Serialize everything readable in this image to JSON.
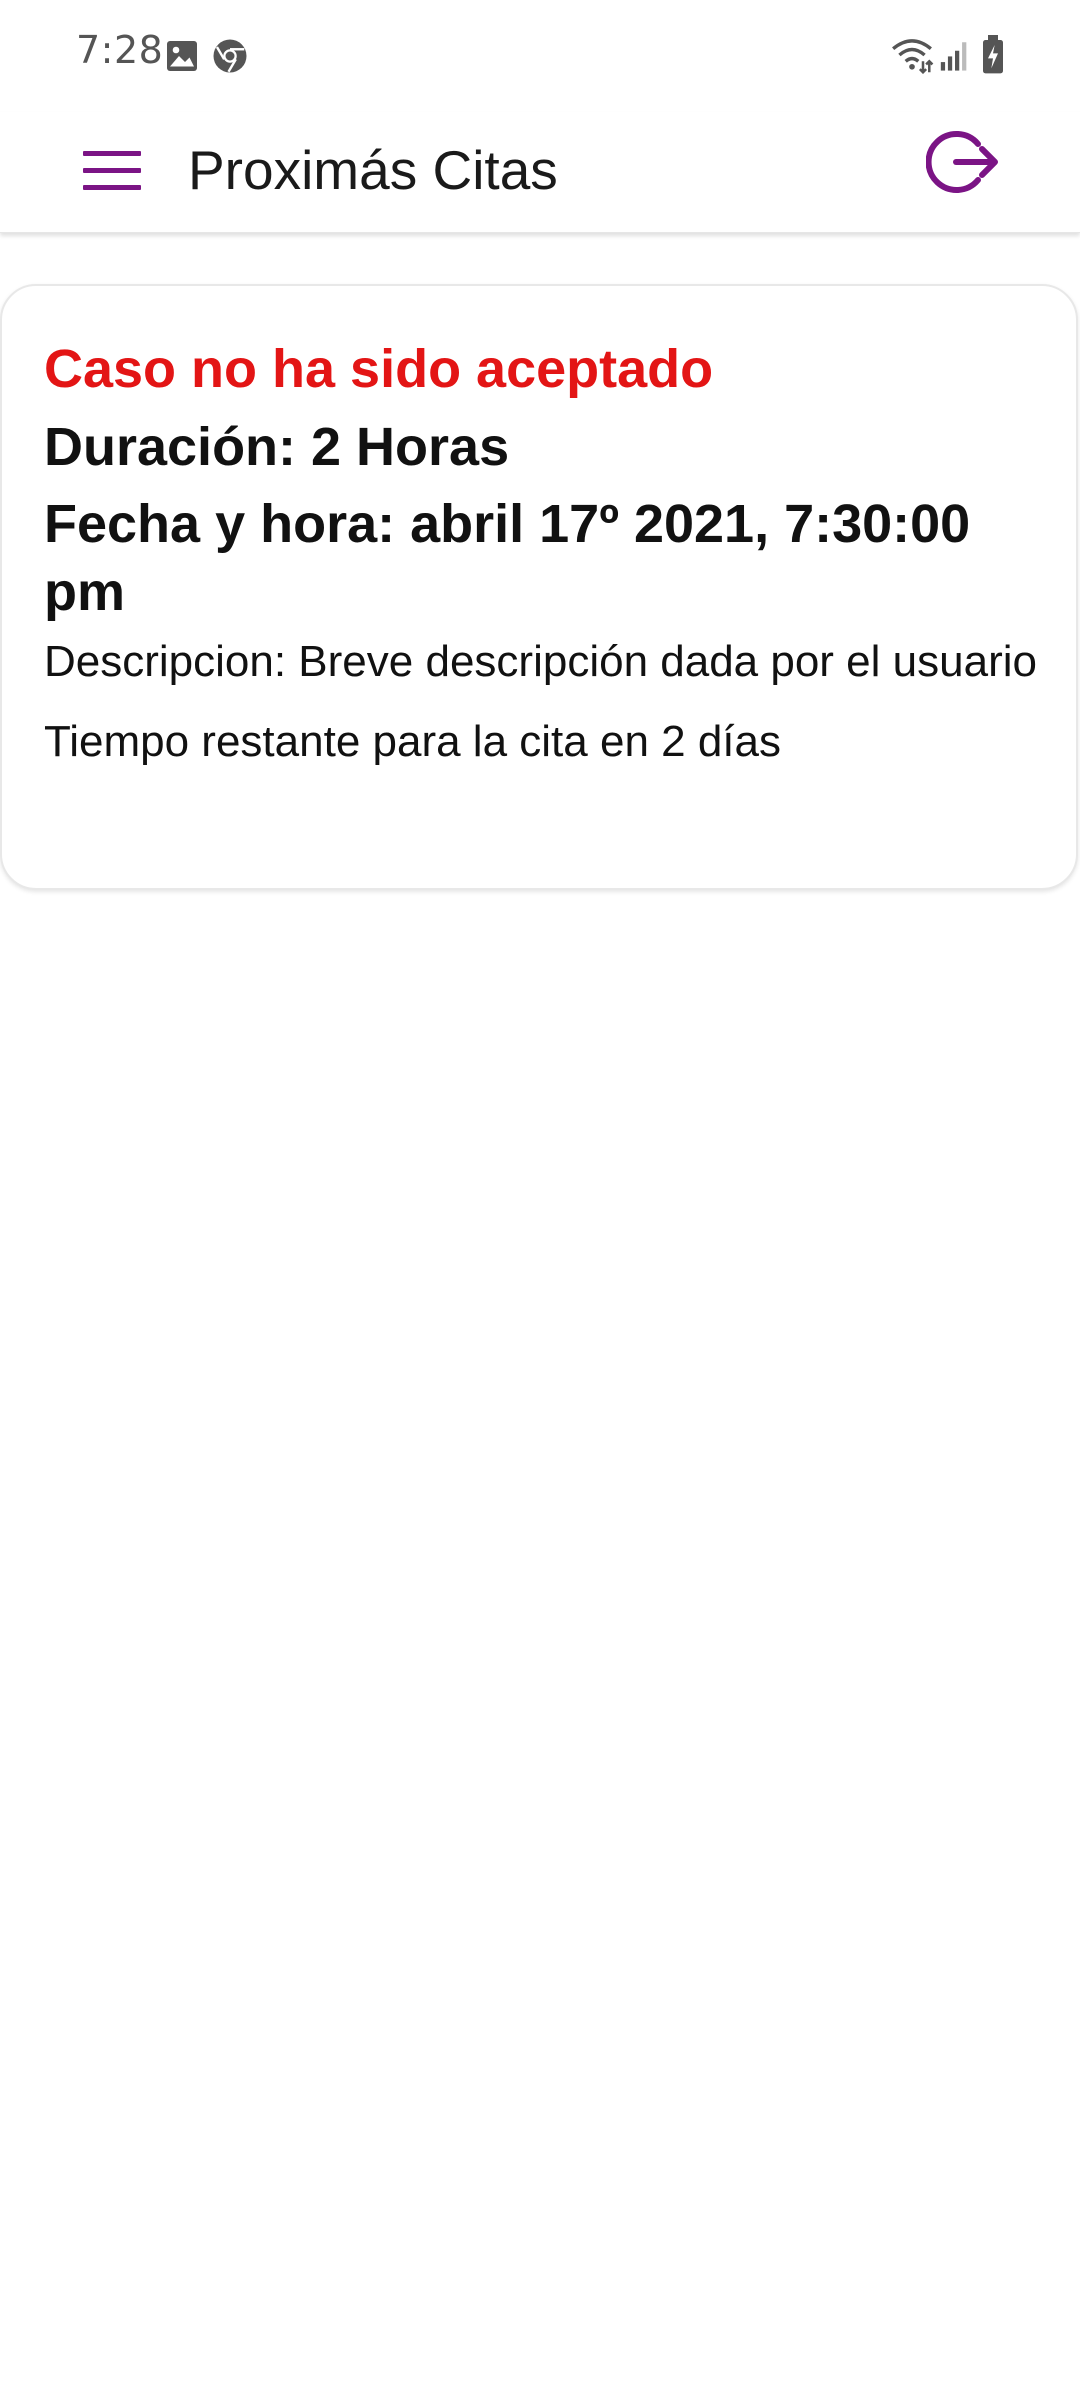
{
  "status_bar": {
    "time": "7:28",
    "left_icons": [
      "gallery-icon",
      "chrome-icon"
    ],
    "right_icons": [
      "wifi-icon",
      "signal-icon",
      "battery-charging-icon"
    ]
  },
  "app_bar": {
    "title": "Proximás Citas",
    "menu_icon": "hamburger-menu-icon",
    "logout_icon": "logout-icon",
    "accent_color": "#7B1485"
  },
  "appointment": {
    "status": "Caso no ha sido aceptado",
    "status_color": "#E31515",
    "duration": "Duración: 2 Horas",
    "datetime": "Fecha y hora: abril 17º 2021, 7:30:00 pm",
    "description": "Descripcion: Breve descripción dada por el usuario",
    "remaining": "Tiempo restante para la cita en 2 días"
  }
}
